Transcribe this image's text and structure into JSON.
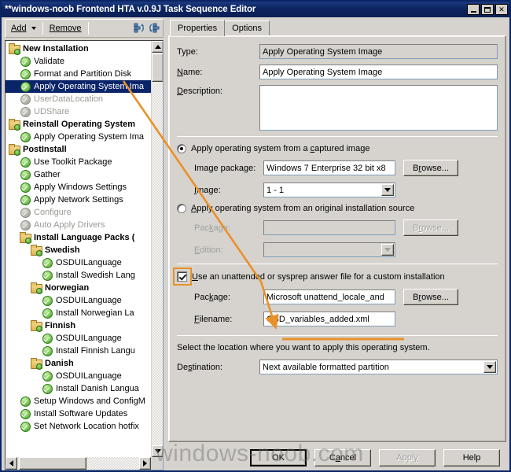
{
  "window": {
    "title": "**windows-noob Frontend HTA v.0.9J Task Sequence Editor",
    "minimize_label": "_",
    "maximize_label": "□",
    "close_label": "✕"
  },
  "toolbar": {
    "add_label": "Add",
    "remove_label": "Remove",
    "move_up_icon": "move-up-icon",
    "move_down_icon": "move-down-icon"
  },
  "tree": {
    "items": [
      {
        "label": "New Installation",
        "indent": 1,
        "icon": "folder",
        "bold": true,
        "disabled": false,
        "selected": false
      },
      {
        "label": "Validate",
        "indent": 2,
        "icon": "check",
        "bold": false,
        "disabled": false,
        "selected": false
      },
      {
        "label": "Format and Partition Disk",
        "indent": 2,
        "icon": "check",
        "bold": false,
        "disabled": false,
        "selected": false
      },
      {
        "label": "Apply Operating System Ima",
        "indent": 2,
        "icon": "check",
        "bold": false,
        "disabled": false,
        "selected": true
      },
      {
        "label": "UserDataLocation",
        "indent": 2,
        "icon": "check",
        "bold": false,
        "disabled": true,
        "selected": false
      },
      {
        "label": "UDShare",
        "indent": 2,
        "icon": "check",
        "bold": false,
        "disabled": true,
        "selected": false
      },
      {
        "label": "Reinstall Operating System",
        "indent": 1,
        "icon": "folder",
        "bold": true,
        "disabled": false,
        "selected": false
      },
      {
        "label": "Apply Operating System Ima",
        "indent": 2,
        "icon": "check",
        "bold": false,
        "disabled": false,
        "selected": false
      },
      {
        "label": "PostInstall",
        "indent": 1,
        "icon": "folder",
        "bold": true,
        "disabled": false,
        "selected": false
      },
      {
        "label": "Use Toolkit Package",
        "indent": 2,
        "icon": "check",
        "bold": false,
        "disabled": false,
        "selected": false
      },
      {
        "label": "Gather",
        "indent": 2,
        "icon": "check",
        "bold": false,
        "disabled": false,
        "selected": false
      },
      {
        "label": "Apply Windows Settings",
        "indent": 2,
        "icon": "check",
        "bold": false,
        "disabled": false,
        "selected": false
      },
      {
        "label": "Apply Network Settings",
        "indent": 2,
        "icon": "check",
        "bold": false,
        "disabled": false,
        "selected": false
      },
      {
        "label": "Configure",
        "indent": 2,
        "icon": "check",
        "bold": false,
        "disabled": true,
        "selected": false
      },
      {
        "label": "Auto Apply Drivers",
        "indent": 2,
        "icon": "check",
        "bold": false,
        "disabled": true,
        "selected": false
      },
      {
        "label": "Install Language Packs (",
        "indent": 2,
        "icon": "folder",
        "bold": true,
        "disabled": false,
        "selected": false
      },
      {
        "label": "Swedish",
        "indent": 3,
        "icon": "folder",
        "bold": true,
        "disabled": false,
        "selected": false
      },
      {
        "label": "OSDUILanguage",
        "indent": 4,
        "icon": "check",
        "bold": false,
        "disabled": false,
        "selected": false
      },
      {
        "label": "Install Swedish Lang",
        "indent": 4,
        "icon": "check",
        "bold": false,
        "disabled": false,
        "selected": false
      },
      {
        "label": "Norwegian",
        "indent": 3,
        "icon": "folder",
        "bold": true,
        "disabled": false,
        "selected": false
      },
      {
        "label": "OSDUILanguage",
        "indent": 4,
        "icon": "check",
        "bold": false,
        "disabled": false,
        "selected": false
      },
      {
        "label": "Install Norwegian La",
        "indent": 4,
        "icon": "check",
        "bold": false,
        "disabled": false,
        "selected": false
      },
      {
        "label": "Finnish",
        "indent": 3,
        "icon": "folder",
        "bold": true,
        "disabled": false,
        "selected": false
      },
      {
        "label": "OSDUILanguage",
        "indent": 4,
        "icon": "check",
        "bold": false,
        "disabled": false,
        "selected": false
      },
      {
        "label": "Install Finnish Langu",
        "indent": 4,
        "icon": "check",
        "bold": false,
        "disabled": false,
        "selected": false
      },
      {
        "label": "Danish",
        "indent": 3,
        "icon": "folder",
        "bold": true,
        "disabled": false,
        "selected": false
      },
      {
        "label": "OSDUILanguage",
        "indent": 4,
        "icon": "check",
        "bold": false,
        "disabled": false,
        "selected": false
      },
      {
        "label": "Install Danish Langua",
        "indent": 4,
        "icon": "check",
        "bold": false,
        "disabled": false,
        "selected": false
      },
      {
        "label": "Setup Windows and ConfigM",
        "indent": 2,
        "icon": "check",
        "bold": false,
        "disabled": false,
        "selected": false
      },
      {
        "label": "Install Software Updates",
        "indent": 2,
        "icon": "check",
        "bold": false,
        "disabled": false,
        "selected": false
      },
      {
        "label": "Set Network Location hotfix",
        "indent": 2,
        "icon": "check",
        "bold": false,
        "disabled": false,
        "selected": false
      }
    ]
  },
  "tabs": [
    {
      "label": "Properties",
      "active": true
    },
    {
      "label": "Options",
      "active": false
    }
  ],
  "properties": {
    "type_label": "Type:",
    "type_value": "Apply Operating System Image",
    "name_label": "Name:",
    "name_value": "Apply Operating System Image",
    "description_label": "Description:",
    "description_value": "",
    "radio_captured_label": "Apply operating system from a captured image",
    "radio_captured_selected": true,
    "image_package_label": "Image package:",
    "image_package_value": "Windows 7 Enterprise 32 bit x8",
    "image_package_browse": "Browse...",
    "image_label": "Image:",
    "image_value": "1 - 1",
    "radio_original_label": "Apply operating system from an original installation source",
    "radio_original_selected": false,
    "package_label": "Package:",
    "package_value": "",
    "package_browse": "Browse...",
    "edition_label": "Edition:",
    "edition_value": "",
    "unattend_checkbox_label": "Use an unattended or sysprep answer file for a custom installation",
    "unattend_checked": true,
    "unattend_package_label": "Package:",
    "unattend_package_value": "Microsoft unattend_locale_and",
    "unattend_package_browse": "Browse...",
    "filename_label": "Filename:",
    "filename_value": "OSD_variables_added.xml",
    "destination_hint": "Select the location where you want to apply this operating system.",
    "destination_label": "Destination:",
    "destination_value": "Next available formatted partition"
  },
  "footer": {
    "ok_label": "OK",
    "cancel_label": "Cancel",
    "apply_label": "Apply",
    "apply_disabled": true,
    "help_label": "Help"
  },
  "watermark": "windows-noob.com",
  "colors": {
    "title_bar": "#0c2460",
    "selection": "#0a246a",
    "annotation": "#e8912a",
    "dialog_face": "#d6d3ce"
  }
}
